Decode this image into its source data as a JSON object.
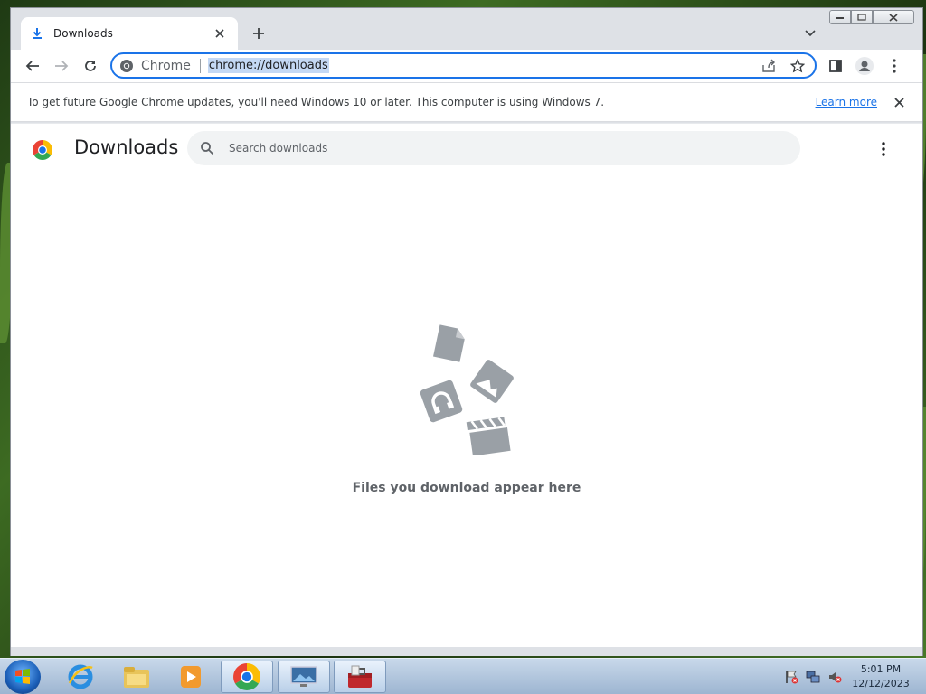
{
  "tab": {
    "title": "Downloads"
  },
  "omnibox": {
    "site_label": "Chrome",
    "url": "chrome://downloads"
  },
  "infobar": {
    "message": "To get future Google Chrome updates, you'll need Windows 10 or later. This computer is using Windows 7.",
    "link": "Learn more"
  },
  "page": {
    "title": "Downloads",
    "search_placeholder": "Search downloads",
    "empty_message": "Files you download appear here"
  },
  "taskbar": {
    "apps": [
      "internet-explorer",
      "file-explorer",
      "media-player",
      "chrome",
      "remote-desktop",
      "toolbox"
    ],
    "clock_time": "5:01 PM",
    "clock_date": "12/12/2023"
  },
  "colors": {
    "accent": "#1a73e8",
    "illustration": "#9aa0a6"
  }
}
